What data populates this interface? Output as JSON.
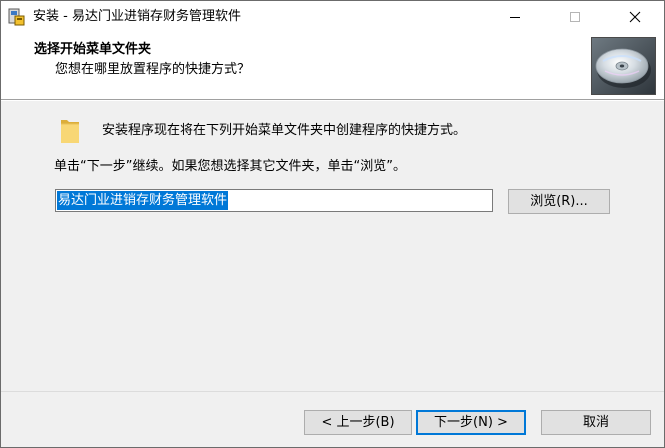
{
  "window": {
    "title": "安装 - 易达门业进销存财务管理软件",
    "app_icon": "installer-icon",
    "controls": [
      "minimize-icon",
      "maximize-icon",
      "close-icon"
    ]
  },
  "header": {
    "title": "选择开始菜单文件夹",
    "subtitle": "您想在哪里放置程序的快捷方式？",
    "image": "cd-disc-icon"
  },
  "body": {
    "folder_icon": "folder-icon",
    "intro": "安装程序现在将在下列开始菜单文件夹中创建程序的快捷方式。",
    "instruction": "单击“下一步”继续。如果您想选择其它文件夹，单击“浏览”。",
    "folder_value": "易达门业进销存财务管理软件",
    "browse_label": "浏览(R)..."
  },
  "footer": {
    "back_label": "< 上一步(B)",
    "next_label": "下一步(N) >",
    "cancel_label": "取消"
  },
  "colors": {
    "selection": "#0078d7",
    "button_face": "#e1e1e1",
    "dialog_bg": "#f0f0f0"
  }
}
